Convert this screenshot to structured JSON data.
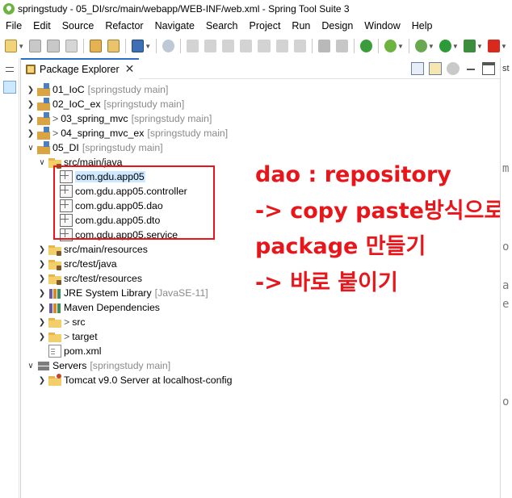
{
  "window": {
    "title": "springstudy - 05_DI/src/main/webapp/WEB-INF/web.xml - Spring Tool Suite 3",
    "app_icon": "spring-leaf-icon"
  },
  "menu": [
    "File",
    "Edit",
    "Source",
    "Refactor",
    "Navigate",
    "Search",
    "Project",
    "Run",
    "Design",
    "Window",
    "Help"
  ],
  "view": {
    "tab_label": "Package Explorer",
    "tab_close": "✕"
  },
  "tree": [
    {
      "label": "01_IoC",
      "sub": "[springstudy main]"
    },
    {
      "label": "02_IoC_ex",
      "sub": "[springstudy main]"
    },
    {
      "decor": ">",
      "label": "03_spring_mvc",
      "sub": "[springstudy main]"
    },
    {
      "decor": ">",
      "label": "04_spring_mvc_ex",
      "sub": "[springstudy main]"
    },
    {
      "label": "05_DI",
      "sub": "[springstudy main]"
    },
    {
      "label": "src/main/java"
    },
    {
      "label": "com.gdu.app05"
    },
    {
      "label": "com.gdu.app05.controller"
    },
    {
      "label": "com.gdu.app05.dao"
    },
    {
      "label": "com.gdu.app05.dto"
    },
    {
      "label": "com.gdu.app05.service"
    },
    {
      "label": "src/main/resources"
    },
    {
      "label": "src/test/java"
    },
    {
      "label": "src/test/resources"
    },
    {
      "label": "JRE System Library",
      "sub": "[JavaSE-11]"
    },
    {
      "label": "Maven Dependencies"
    },
    {
      "decor": ">",
      "label": "src"
    },
    {
      "decor": ">",
      "label": "target"
    },
    {
      "label": "pom.xml"
    },
    {
      "label": "Servers",
      "sub": "[springstudy main]"
    },
    {
      "label": "Tomcat v9.0 Server at localhost-config"
    }
  ],
  "annotation": {
    "lines": [
      "dao : repository",
      "-> copy paste방식으로",
      "package 만들기",
      "-> 바로 붙이기"
    ],
    "color": "#e8161a"
  },
  "editor_edge": {
    "tab": "st",
    "chars": [
      "m",
      "o",
      "a",
      "e",
      "o"
    ]
  }
}
